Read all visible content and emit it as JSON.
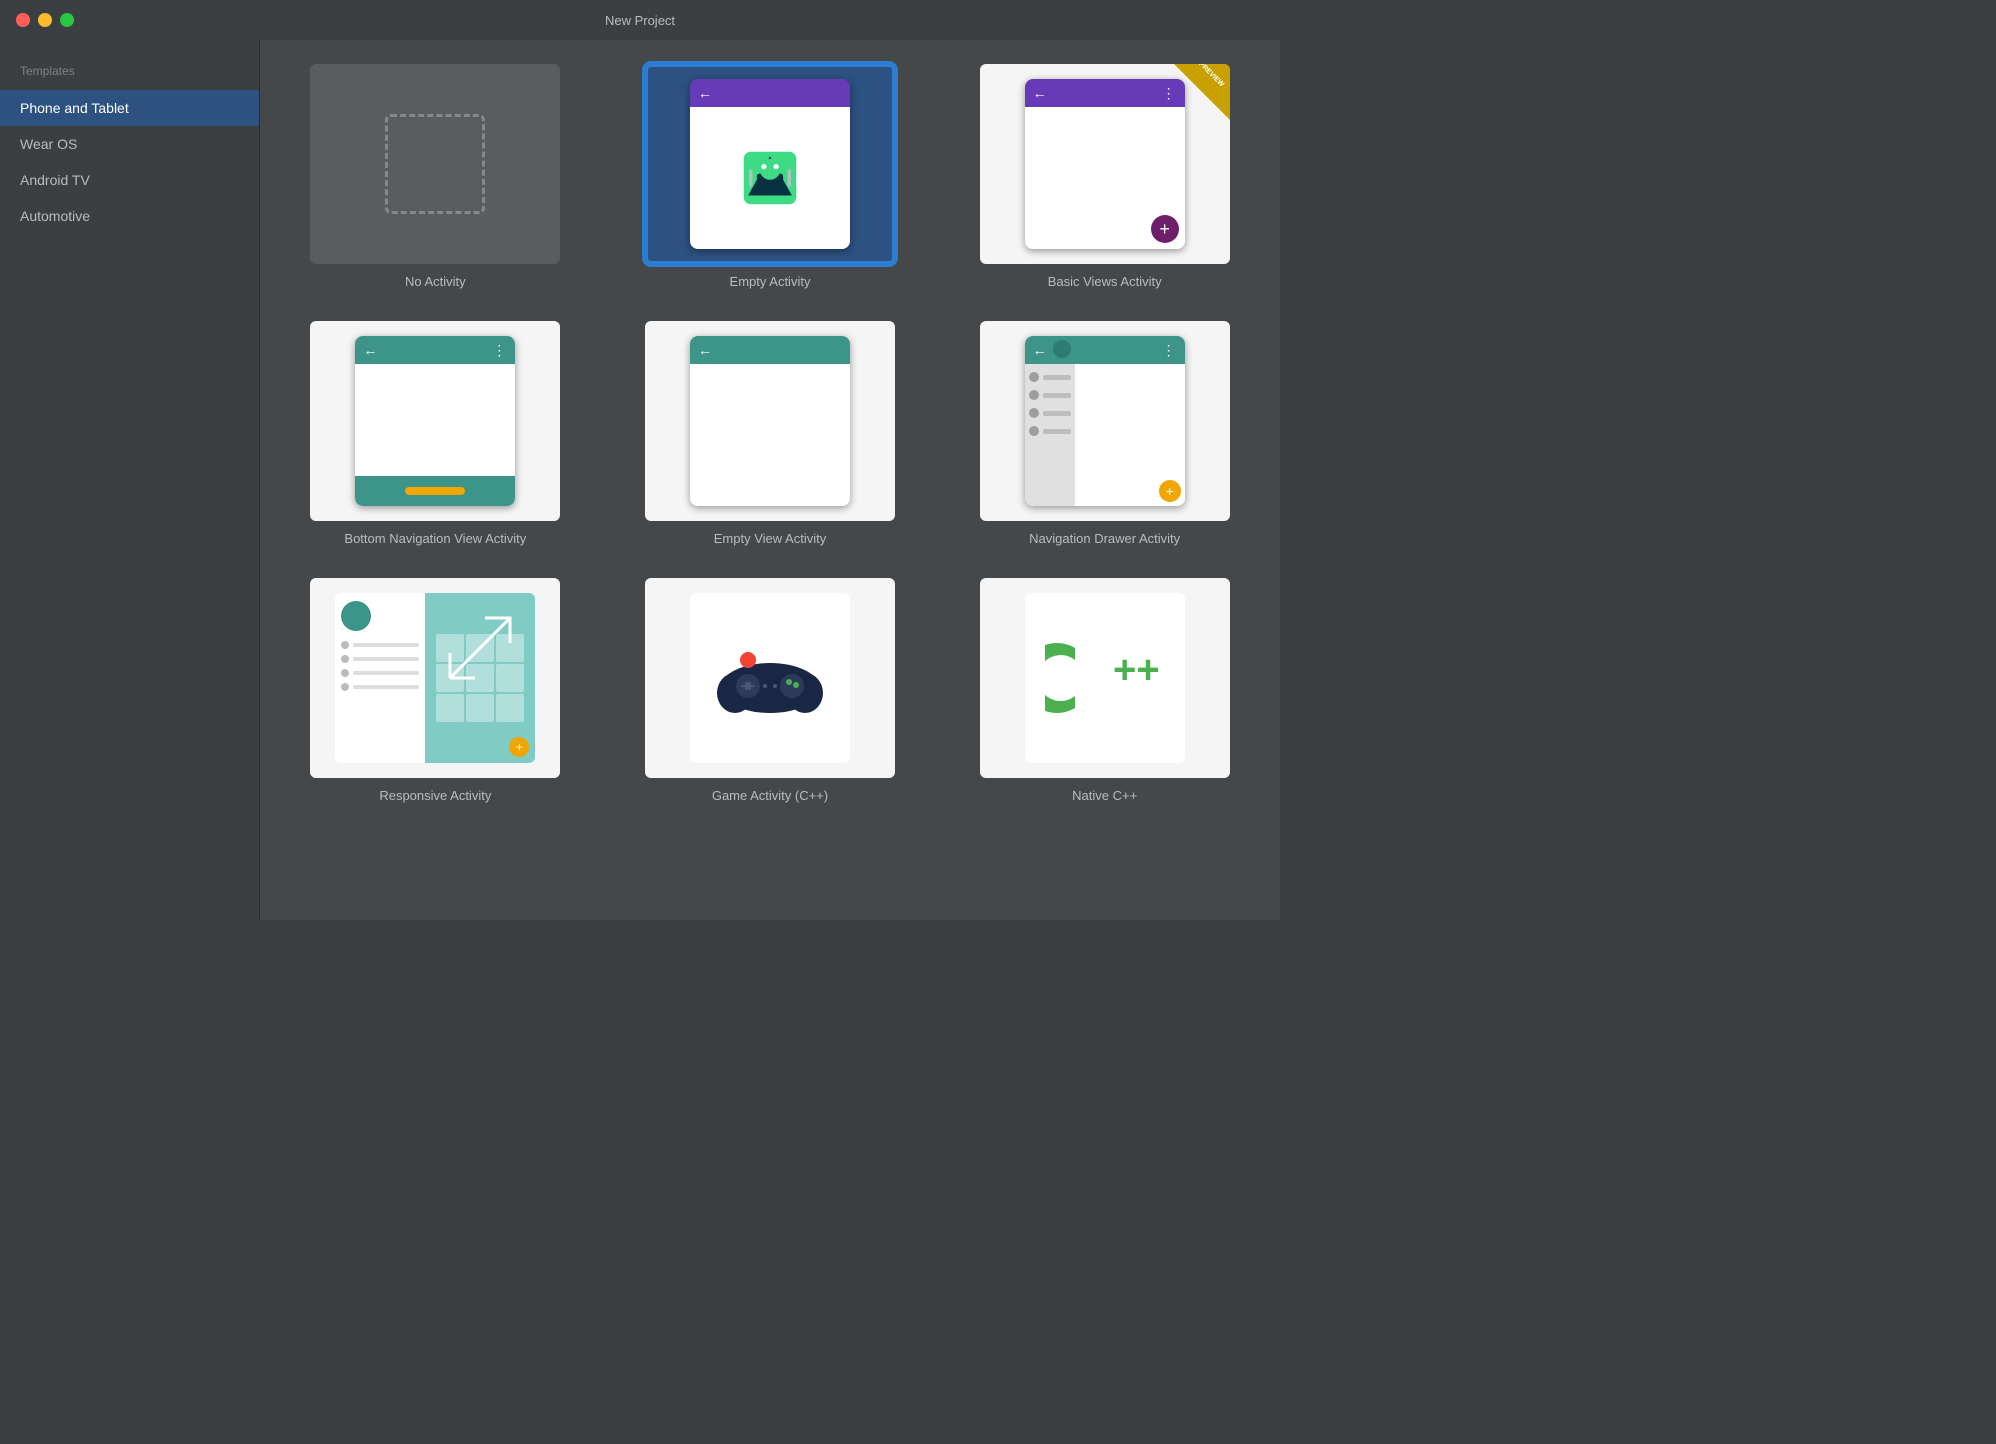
{
  "window": {
    "title": "New Project"
  },
  "sidebar": {
    "section_label": "Templates",
    "items": [
      {
        "id": "phone-tablet",
        "label": "Phone and Tablet",
        "active": true
      },
      {
        "id": "wear-os",
        "label": "Wear OS",
        "active": false
      },
      {
        "id": "android-tv",
        "label": "Android TV",
        "active": false
      },
      {
        "id": "automotive",
        "label": "Automotive",
        "active": false
      }
    ]
  },
  "templates": [
    {
      "id": "no-activity",
      "label": "No Activity",
      "selected": false
    },
    {
      "id": "empty-activity",
      "label": "Empty Activity",
      "selected": true
    },
    {
      "id": "basic-views",
      "label": "Basic Views Activity",
      "selected": false
    },
    {
      "id": "bottom-nav",
      "label": "Bottom Navigation View Activity",
      "selected": false
    },
    {
      "id": "empty-view",
      "label": "Empty View Activity",
      "selected": false
    },
    {
      "id": "nav-drawer",
      "label": "Navigation Drawer Activity",
      "selected": false
    },
    {
      "id": "responsive",
      "label": "Responsive Activity",
      "selected": false
    },
    {
      "id": "game-cpp",
      "label": "Game Activity (C++)",
      "selected": false
    },
    {
      "id": "native-cpp",
      "label": "Native C++",
      "selected": false
    }
  ],
  "icons": {
    "close": "●",
    "minimize": "●",
    "maximize": "●",
    "arrow_back": "←",
    "more_vert": "⋮",
    "add": "+",
    "preview_label": "PREVIEW"
  }
}
